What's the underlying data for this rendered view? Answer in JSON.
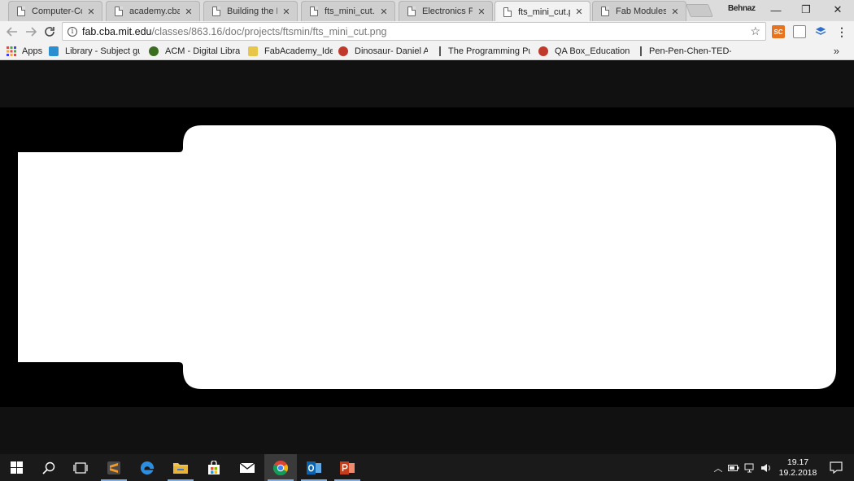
{
  "browser": {
    "tabs": [
      {
        "label": "Computer-Cont",
        "active": false
      },
      {
        "label": "academy.cba.m",
        "active": false
      },
      {
        "label": "Building the Fa",
        "active": false
      },
      {
        "label": "fts_mini_cut.pn",
        "active": false
      },
      {
        "label": "Electronics Prod",
        "active": false
      },
      {
        "label": "fts_mini_cut.pn",
        "active": true
      },
      {
        "label": "Fab Modules",
        "active": false
      }
    ],
    "profile_name": "Behnaz",
    "window_controls": {
      "minimize": "—",
      "restore": "❐",
      "close": "✕"
    },
    "address": {
      "host": "fab.cba.mit.edu",
      "path": "/classes/863.16/doc/projects/ftsmin/fts_mini_cut.png"
    },
    "extensions": [
      {
        "name": "sc-extension-icon",
        "text": "SC",
        "color": "#e8731f"
      },
      {
        "name": "document-extension-icon",
        "text": "",
        "color": "#9a9a9a"
      },
      {
        "name": "layers-extension-icon",
        "text": "",
        "color": "#2d6fd1"
      }
    ],
    "bookmarks": {
      "apps_label": "Apps",
      "items": [
        {
          "label": "Library - Subject guid",
          "icon": "library-icon",
          "color": "#2a8fd0"
        },
        {
          "label": "ACM - Digital Library",
          "icon": "acm-icon",
          "color": "#3a6d1f"
        },
        {
          "label": "FabAcademy_Ideas",
          "icon": "folder-icon",
          "color": "#e8c64a"
        },
        {
          "label": "Dinosaur- Daniel Am",
          "icon": "globe-icon",
          "color": "#c0392b"
        },
        {
          "label": "The Programming Pu",
          "icon": "doc-icon",
          "color": ""
        },
        {
          "label": "QA Box_Educational",
          "icon": "globe-icon",
          "color": "#c0392b"
        },
        {
          "label": "Pen-Pen-Chen-TED-E",
          "icon": "doc-icon",
          "color": ""
        }
      ],
      "more": "»"
    }
  },
  "content": {
    "image_fill": "#ffffff",
    "background": "#000000"
  },
  "taskbar": {
    "apps": [
      {
        "name": "sublime-text-icon",
        "active": false,
        "pinned_open": true
      },
      {
        "name": "edge-icon",
        "active": false,
        "pinned_open": false
      },
      {
        "name": "file-explorer-icon",
        "active": false,
        "pinned_open": true
      },
      {
        "name": "store-icon",
        "active": false,
        "pinned_open": false
      },
      {
        "name": "mail-icon",
        "active": false,
        "pinned_open": false
      },
      {
        "name": "chrome-icon",
        "active": true,
        "pinned_open": true
      },
      {
        "name": "outlook-icon",
        "active": false,
        "pinned_open": true
      },
      {
        "name": "powerpoint-icon",
        "active": false,
        "pinned_open": true
      }
    ],
    "clock": {
      "time": "19.17",
      "date": "19.2.2018"
    }
  }
}
